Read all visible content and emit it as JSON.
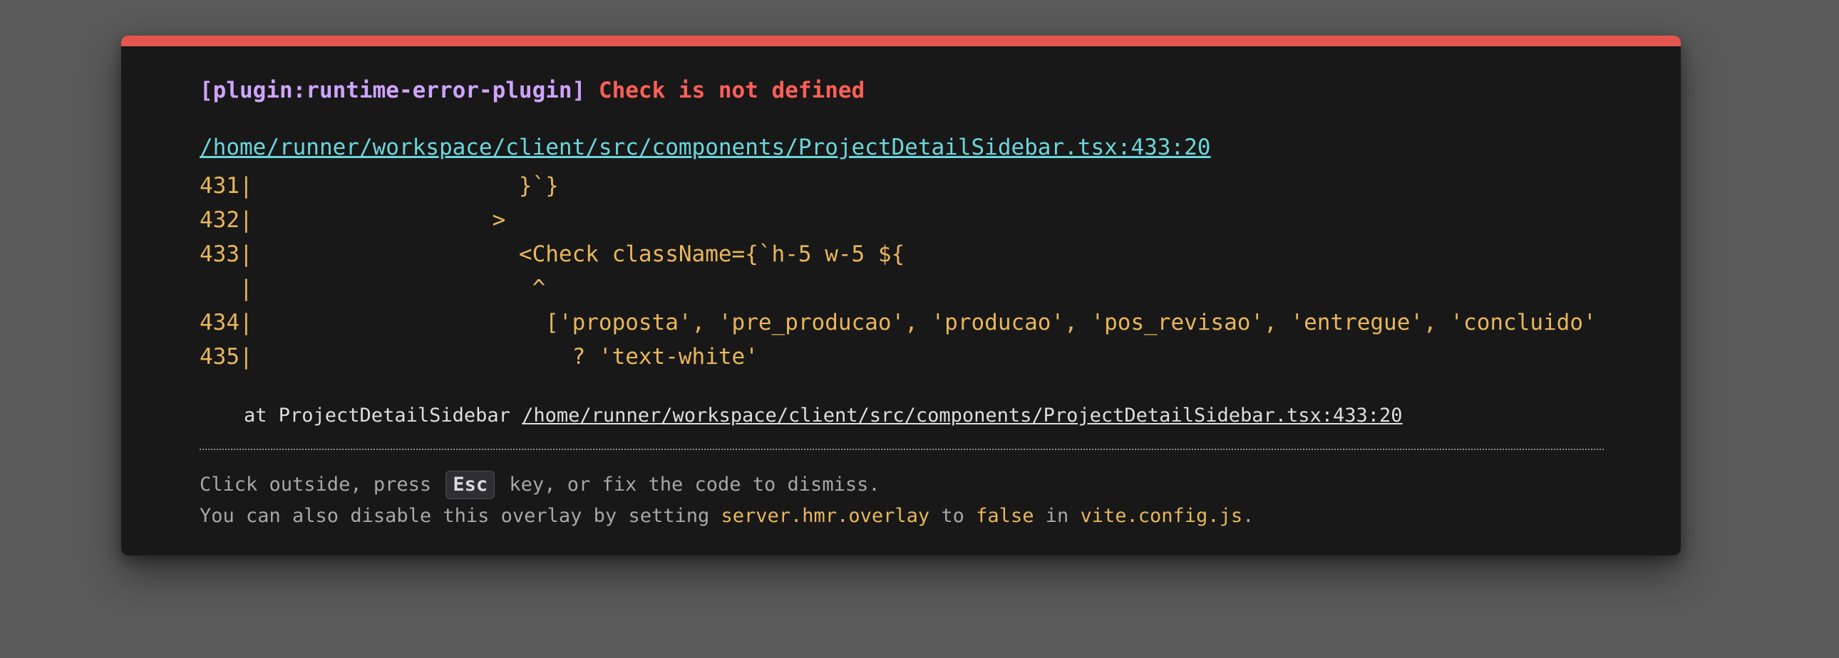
{
  "overlay": {
    "plugin": "[plugin:runtime-error-plugin]",
    "message": "Check is not defined",
    "file": "/home/runner/workspace/client/src/components/ProjectDetailSidebar.tsx:433:20",
    "frame": [
      "431|                    }`}",
      "432|                  >",
      "433|                    <Check className={`h-5 w-5 ${",
      "   |                     ^",
      "434|                      ['proposta', 'pre_producao', 'producao', 'pos_revisao', 'entregue', 'concluido'",
      "435|                        ? 'text-white'"
    ],
    "stack": {
      "prefix": "at ProjectDetailSidebar",
      "link": "/home/runner/workspace/client/src/components/ProjectDetailSidebar.tsx:433:20"
    },
    "tip": {
      "line1_pre": "Click outside, press",
      "esc_key": "Esc",
      "line1_post": "key, or fix the code to dismiss.",
      "line2_pre": "You can also disable this overlay by setting",
      "setting": "server.hmr.overlay",
      "to": "to",
      "value": "false",
      "in": "in",
      "config_file": "vite.config.js",
      "period": "."
    },
    "colors": {
      "accent_bar": "#e5554f",
      "plugin": "#cfa4ff",
      "message": "#ff5f57",
      "link": "#6cd6db",
      "code": "#e8b65a"
    }
  }
}
